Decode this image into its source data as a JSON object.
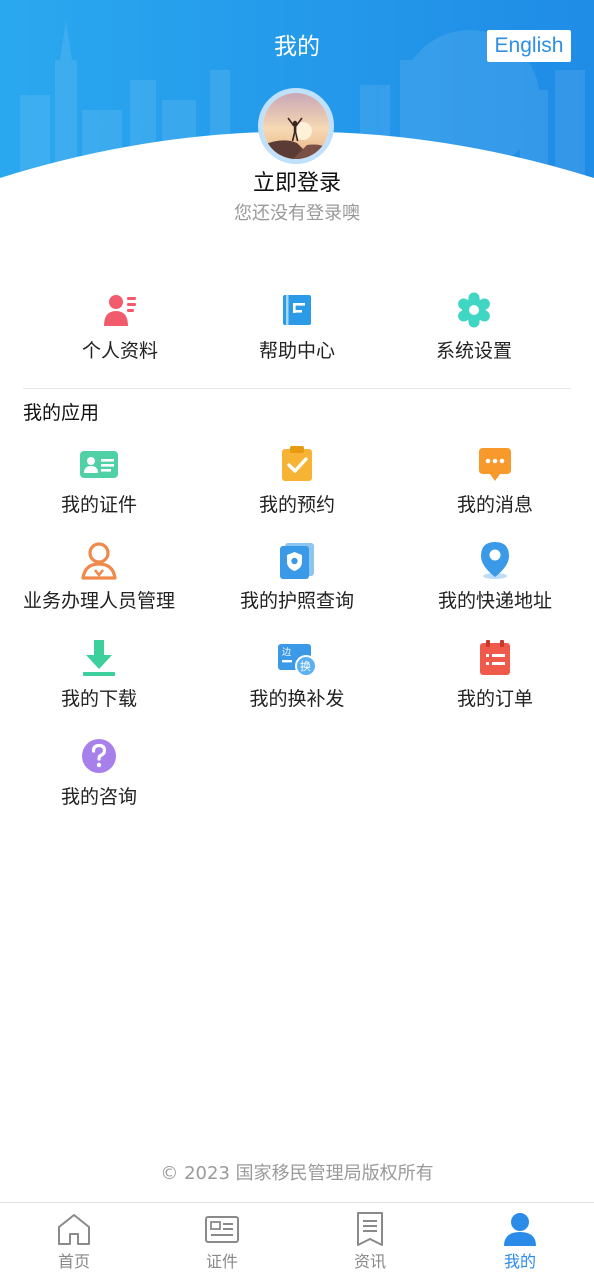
{
  "header": {
    "title": "我的",
    "language_button": "English",
    "gradient_start": "#2aa8ef",
    "gradient_end": "#1f8ce6"
  },
  "profile": {
    "login_title": "立即登录",
    "login_subtitle": "您还没有登录噢"
  },
  "quick_links": [
    {
      "label": "个人资料",
      "icon": "person-card-icon",
      "color": "#f15b6c"
    },
    {
      "label": "帮助中心",
      "icon": "book-icon",
      "color": "#2b9be8"
    },
    {
      "label": "系统设置",
      "icon": "gear-icon",
      "color": "#3fd6c4"
    }
  ],
  "apps": {
    "section_title": "我的应用",
    "items": [
      {
        "label": "我的证件",
        "icon": "id-card-icon",
        "color": "#4fd1a5"
      },
      {
        "label": "我的预约",
        "icon": "clipboard-check-icon",
        "color": "#f7b334"
      },
      {
        "label": "我的消息",
        "icon": "chat-bubble-icon",
        "color": "#f7992b"
      },
      {
        "label": "业务办理人员管理",
        "icon": "user-outline-icon",
        "color": "#f08a4b"
      },
      {
        "label": "我的护照查询",
        "icon": "passport-icon",
        "color": "#3a9ae8"
      },
      {
        "label": "我的快递地址",
        "icon": "location-pin-icon",
        "color": "#3a9ae8"
      },
      {
        "label": "我的下载",
        "icon": "download-icon",
        "color": "#3dcf9c"
      },
      {
        "label": "我的换补发",
        "icon": "exchange-card-icon",
        "color": "#3a9ae8"
      },
      {
        "label": "我的订单",
        "icon": "order-list-icon",
        "color": "#f05a4a"
      },
      {
        "label": "我的咨询",
        "icon": "question-icon",
        "color": "#a780ec"
      }
    ]
  },
  "footer": {
    "copyright": "© 2023 国家移民管理局版权所有"
  },
  "tabbar": {
    "active_color": "#2b8be8",
    "items": [
      {
        "label": "首页",
        "icon": "home-icon"
      },
      {
        "label": "证件",
        "icon": "id-card-outline-icon"
      },
      {
        "label": "资讯",
        "icon": "news-icon"
      },
      {
        "label": "我的",
        "icon": "user-icon",
        "active": true
      }
    ]
  }
}
